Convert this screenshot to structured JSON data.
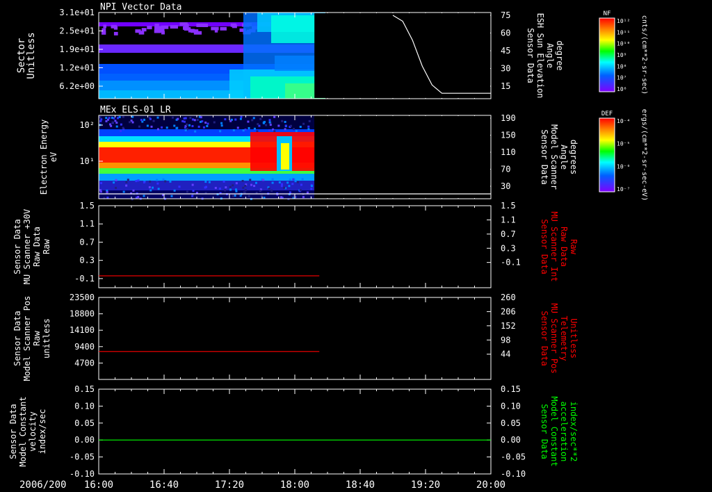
{
  "chart_data": [
    {
      "type": "heatmap",
      "title": "NPI Vector Data",
      "ylabel": [
        "Sector",
        "Unitless"
      ],
      "yticks": [
        "3.1e+01",
        "2.5e+01",
        "1.9e+01",
        "1.2e+01",
        "6.2e+00"
      ],
      "right_label": [
        "Sensor Data",
        "ESH Sun Elevation",
        "Angle",
        "degree"
      ],
      "right_ticks": [
        75,
        60,
        45,
        30,
        15
      ],
      "right_color": "#ffffff",
      "data_end_time": "18:12",
      "overlay_line": {
        "color": "#ffffff",
        "times": [
          "19:00",
          "19:06",
          "19:12",
          "19:18",
          "19:24",
          "19:30",
          "20:00"
        ],
        "values": [
          75,
          70,
          54,
          32,
          16,
          9,
          9
        ]
      },
      "colorbar": {
        "label": "NF",
        "unit": "cnts/(cm**2-sr-sec)",
        "ticks": [
          "10¹²",
          "10¹¹",
          "10¹⁰",
          "10⁹",
          "10⁸",
          "10⁷",
          "10⁶"
        ]
      }
    },
    {
      "type": "heatmap",
      "title": "MEx ELS-01 LR",
      "ylabel": [
        "Electron Energy",
        "eV"
      ],
      "yticks": [
        "10²",
        "10¹"
      ],
      "right_label": [
        "Sensor Data",
        "Model Scanner",
        "Angle",
        "degrees"
      ],
      "right_ticks": [
        190,
        150,
        110,
        70,
        30
      ],
      "right_color": "#ffffff",
      "data_end_time": "18:12",
      "overlay_line": {
        "color": "#ffffff",
        "times": [
          "16:00",
          "20:00"
        ],
        "values": [
          12,
          12
        ]
      },
      "colorbar": {
        "label": "DEF",
        "unit": "ergs/(cm**2-sr-sec-eV)",
        "ticks": [
          "10⁻⁴",
          "10⁻⁵",
          "10⁻⁶",
          "10⁻⁷"
        ]
      }
    },
    {
      "type": "line",
      "ylabel": [
        "Sensor Data",
        "MU Scanner +30V",
        "Raw Data",
        "Raw"
      ],
      "left_ticks": [
        1.5,
        1.1,
        0.7,
        0.3,
        -0.1
      ],
      "left_tick_labels": [
        "1.5",
        "1.1",
        "0.7",
        "0.3",
        "-0.1"
      ],
      "ylim": [
        -0.3,
        1.5
      ],
      "right_label": [
        "Sensor Data",
        "MU Scanner Int",
        "Raw Data",
        "Raw"
      ],
      "right_ticks": [
        "1.5",
        "1.1",
        "0.7",
        "0.3",
        "-0.1"
      ],
      "right_color": "#ff0000",
      "series": [
        {
          "color": "#ff0000",
          "times": [
            "16:00",
            "18:15"
          ],
          "values": [
            -0.04,
            -0.04
          ]
        }
      ]
    },
    {
      "type": "line",
      "ylabel": [
        "Sensor Data",
        "Model Scanner Pos",
        "Raw",
        "unitless"
      ],
      "left_ticks": [
        23500,
        18800,
        14100,
        9400,
        4700
      ],
      "left_tick_labels": [
        "23500",
        "18800",
        "14100",
        "9400",
        "4700"
      ],
      "ylim": [
        0,
        23500
      ],
      "right_label": [
        "Sensor Data",
        "MU Scanner Pos",
        "Telemetry",
        "Unitless"
      ],
      "right_ticks": [
        "260",
        "206",
        "152",
        "98",
        "44"
      ],
      "right_color": "#ff0000",
      "series": [
        {
          "color": "#ff0000",
          "times": [
            "16:00",
            "18:15"
          ],
          "values": [
            8000,
            8000
          ]
        }
      ]
    },
    {
      "type": "line",
      "ylabel": [
        "Sensor Data",
        "Model Constant",
        "velocity",
        "index/sec"
      ],
      "left_ticks": [
        0.15,
        0.1,
        0.05,
        0.0,
        -0.05,
        -0.1
      ],
      "left_tick_labels": [
        "0.15",
        "0.10",
        "0.05",
        "0.00",
        "-0.05",
        "-0.10"
      ],
      "ylim": [
        -0.1,
        0.15
      ],
      "right_label": [
        "Sensor Data",
        "Model Constant",
        "acceleration",
        "index/sec**2"
      ],
      "right_ticks": [
        "0.15",
        "0.10",
        "0.05",
        "0.00",
        "-0.05",
        "-0.10"
      ],
      "right_color": "#00ff00",
      "series": [
        {
          "color": "#00ff00",
          "times": [
            "16:00",
            "20:00"
          ],
          "values": [
            0.0,
            0.0
          ]
        }
      ]
    }
  ],
  "x_axis": {
    "date": "2006/200",
    "tick_labels": [
      "16:00",
      "16:40",
      "17:20",
      "18:00",
      "18:40",
      "19:20",
      "20:00"
    ],
    "range": [
      "16:00",
      "20:00"
    ]
  }
}
